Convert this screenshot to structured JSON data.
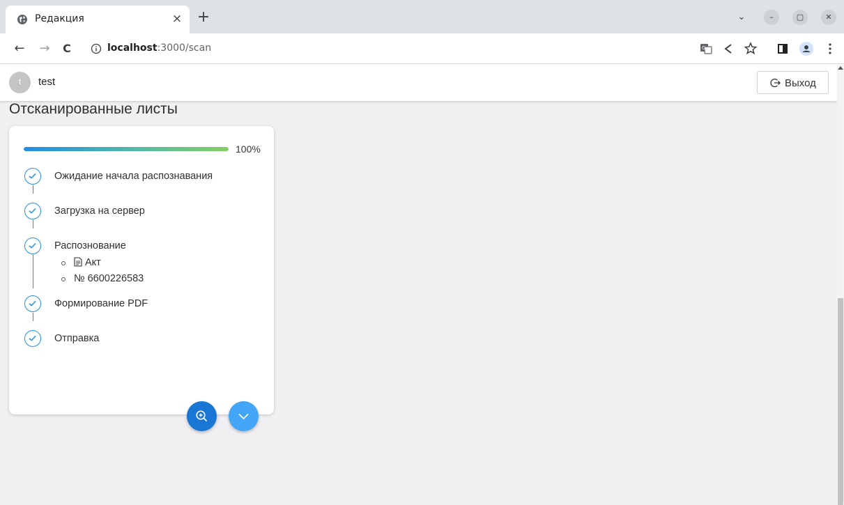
{
  "browser": {
    "tab": {
      "title": "Редакция",
      "close_glyph": "×",
      "favicon": "globe-icon"
    },
    "new_tab_glyph": "+",
    "tab_search_glyph": "⌄",
    "window_controls": {
      "minimize": "–",
      "maximize": "▢",
      "close": "✕"
    },
    "toolbar": {
      "back_glyph": "←",
      "forward_glyph": "→",
      "reload_glyph": "C",
      "url_host": "localhost",
      "url_path": ":3000/scan",
      "icons": [
        "translate-icon",
        "share-icon",
        "bookmark-star-icon",
        "side-panel-icon",
        "profile-icon",
        "menu-dots-icon"
      ]
    }
  },
  "app": {
    "user": {
      "avatar_letter": "t",
      "name": "test"
    },
    "logout_label": "Выход",
    "page_title": "Отсканированные листы",
    "card": {
      "progress_percent": 100,
      "progress_text": "100%",
      "steps": [
        {
          "label": "Ожидание начала распознавания",
          "done": true
        },
        {
          "label": "Загрузка на сервер",
          "done": true
        },
        {
          "label": "Распознование",
          "done": true,
          "sub_items": [
            "Акт",
            "№ 6600226583"
          ]
        },
        {
          "label": "Формирование PDF",
          "done": true
        },
        {
          "label": "Отправка",
          "done": true
        }
      ]
    },
    "fab_buttons": [
      {
        "icon": "zoom-in-icon",
        "color": "#1976d2"
      },
      {
        "icon": "chevron-down-icon",
        "color": "#42a5f5"
      }
    ]
  },
  "colors": {
    "accent": "#1f8ee6",
    "page_bg": "#f0f0f3",
    "tabstrip_bg": "#dee1e6"
  }
}
